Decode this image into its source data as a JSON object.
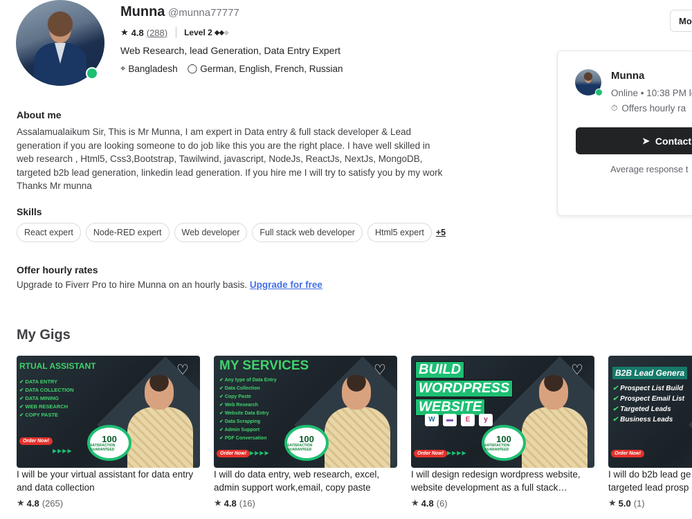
{
  "profile": {
    "name": "Munna",
    "handle": "@munna77777",
    "rating": "4.8",
    "reviews": "(288)",
    "level": "Level 2",
    "tagline": "Web Research, lead Generation, Data Entry Expert",
    "location": "Bangladesh",
    "languages": "German, English, French, Russian",
    "more_button": "Mo"
  },
  "card": {
    "name": "Munna",
    "status": "Online • 10:38 PM lo",
    "offer": "Offers hourly ra",
    "contact": "Contact",
    "avg_response": "Average response t"
  },
  "about": {
    "heading": "About me",
    "text": "Assalamualaikum Sir, This is Mr Munna, I am expert in Data entry & full stack developer & Lead\ngeneration if you are looking someone to do job like this you are the right place. I have well skilled in\nweb research , Html5, Css3,Bootstrap, Tawilwind, javascript, NodeJs, ReactJs, NextJs, MongoDB,\ntargeted b2b lead generation, linkedin lead generation. If you hire me I will try to satisfy you by my work\nThanks Mr munna"
  },
  "skills": {
    "heading": "Skills",
    "items": [
      "React expert",
      "Node-RED expert",
      "Web developer",
      "Full stack web developer",
      "Html5 expert"
    ],
    "more": "+5"
  },
  "offer": {
    "heading": "Offer hourly rates",
    "text": "Upgrade to Fiverr Pro to hire Munna on an hourly basis. ",
    "link": "Upgrade for free"
  },
  "gigs": {
    "heading": "My Gigs",
    "items": [
      {
        "image_title": "RTUAL ASSISTANT",
        "image_list": [
          "DATA ENTRY",
          "DATA COLLECTION",
          "DATA MINING",
          "WEB RESEARCH",
          "COPY PASTE"
        ],
        "description": "I will be your virtual assistant for data entry and data collection",
        "rating": "4.8",
        "count": "(265)"
      },
      {
        "image_title": "MY SERVICES",
        "image_list": [
          "Any type of Data Entry",
          "Data Collection",
          "Copy Paste",
          "Web Research",
          "Website Data Entry",
          "Data Scrapping",
          "Admin Support",
          "PDF Conversation"
        ],
        "description": "I will do data entry, web research, excel, admin support work,email, copy paste",
        "rating": "4.8",
        "count": "(16)"
      },
      {
        "image_title_lines": [
          "BUILD",
          "WORDPRESS",
          "WEBSITE"
        ],
        "description": "I will design redesign wordpress website, website development as a full stack…",
        "rating": "4.8",
        "count": "(6)"
      },
      {
        "image_title": "B2B Lead Genera",
        "image_list": [
          "Prospect List Build",
          "Prospect Email List",
          "Targeted Leads",
          "Business Leads"
        ],
        "description": "I will do b2b lead ge targeted lead prosp",
        "rating": "5.0",
        "count": "(1)"
      }
    ],
    "badge_value": "100",
    "badge_text": "SATISFACTION GUARANTEED",
    "order_now": "Order Now!"
  },
  "colors": {
    "accent": "#1dbf73",
    "link": "#446ee7",
    "dark": "#222325"
  }
}
